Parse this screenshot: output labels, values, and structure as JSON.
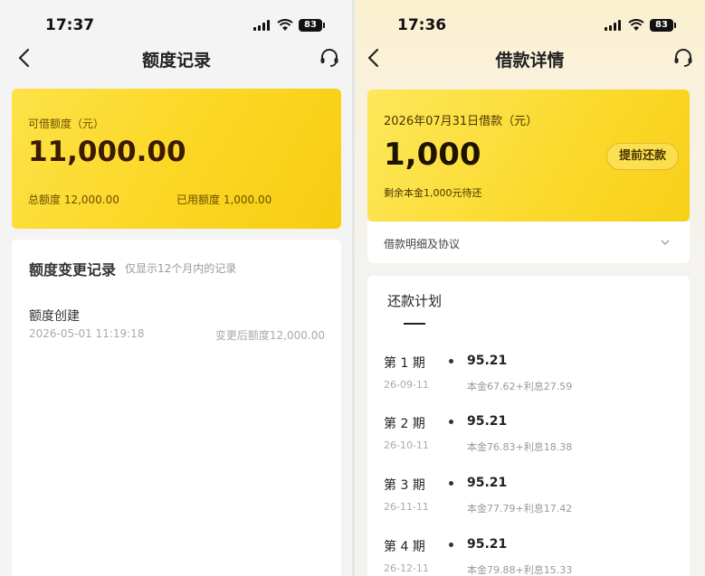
{
  "left": {
    "status": {
      "time": "17:37",
      "battery": "83"
    },
    "nav": {
      "title": "额度记录"
    },
    "quota": {
      "label": "可借额度（元）",
      "amount": "11,000.00",
      "total": "总额度 12,000.00",
      "used": "已用额度 1,000.00"
    },
    "records": {
      "header": "额度变更记录",
      "hint": "仅显示12个月内的记录",
      "items": [
        {
          "title": "额度创建",
          "date": "2026-05-01 11:19:18",
          "after": "变更后额度12,000.00"
        }
      ]
    }
  },
  "right": {
    "status": {
      "time": "17:36",
      "battery": "83"
    },
    "nav": {
      "title": "借款详情"
    },
    "loan": {
      "label": "2026年07月31日借款（元）",
      "amount": "1,000",
      "remain": "剩余本金1,000元待还",
      "prepay_label": "提前还款"
    },
    "detail_row": {
      "label": "借款明细及协议"
    },
    "plan": {
      "header": "还款计划",
      "periods": [
        {
          "name": "第 1 期",
          "date": "26-09-11",
          "amount": "95.21",
          "breakdown": "本金67.62+利息27.59"
        },
        {
          "name": "第 2 期",
          "date": "26-10-11",
          "amount": "95.21",
          "breakdown": "本金76.83+利息18.38"
        },
        {
          "name": "第 3 期",
          "date": "26-11-11",
          "amount": "95.21",
          "breakdown": "本金77.79+利息17.42"
        },
        {
          "name": "第 4 期",
          "date": "26-12-11",
          "amount": "95.21",
          "breakdown": "本金79.88+利息15.33"
        }
      ]
    }
  }
}
